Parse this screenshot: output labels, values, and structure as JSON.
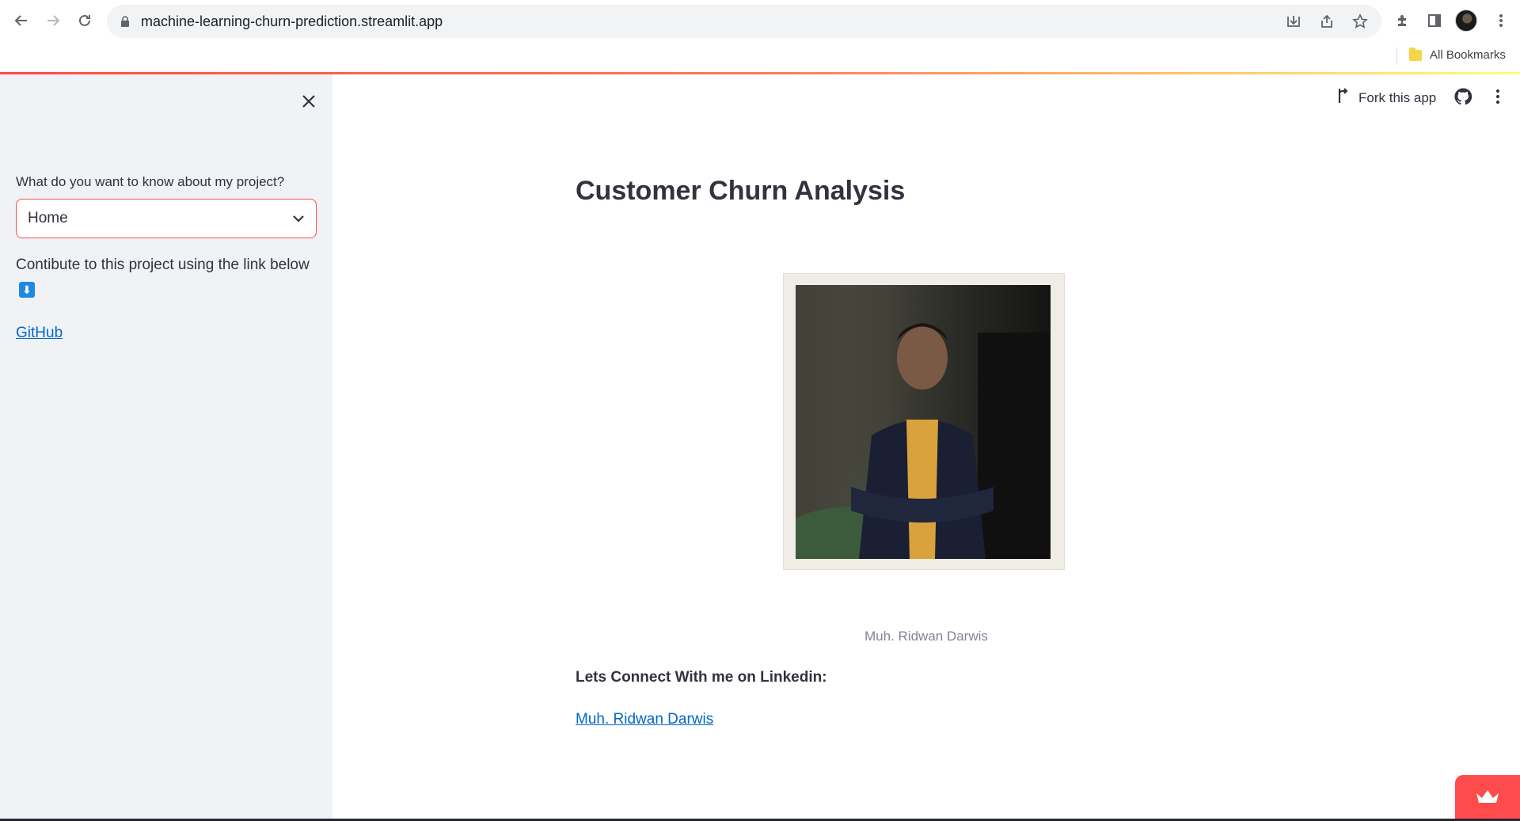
{
  "browser": {
    "url": "machine-learning-churn-prediction.streamlit.app",
    "bookmarks_label": "All Bookmarks"
  },
  "sidebar": {
    "select_label": "What do you want to know about my project?",
    "select_value": "Home",
    "contribute_text": "Contibute to this project using the link below",
    "arrow_emoji": "⬇",
    "github_link": "GitHub"
  },
  "header": {
    "fork_label": "Fork this app"
  },
  "main": {
    "title": "Customer Churn Analysis",
    "image_caption": "Muh. Ridwan Darwis",
    "connect_text": "Lets Connect With me on Linkedin:",
    "linkedin_link": "Muh. Ridwan Darwis"
  },
  "colors": {
    "accent": "#ff4b4b",
    "link": "#0068c9",
    "sidebar_bg": "#f0f2f6",
    "text": "#31333f"
  }
}
